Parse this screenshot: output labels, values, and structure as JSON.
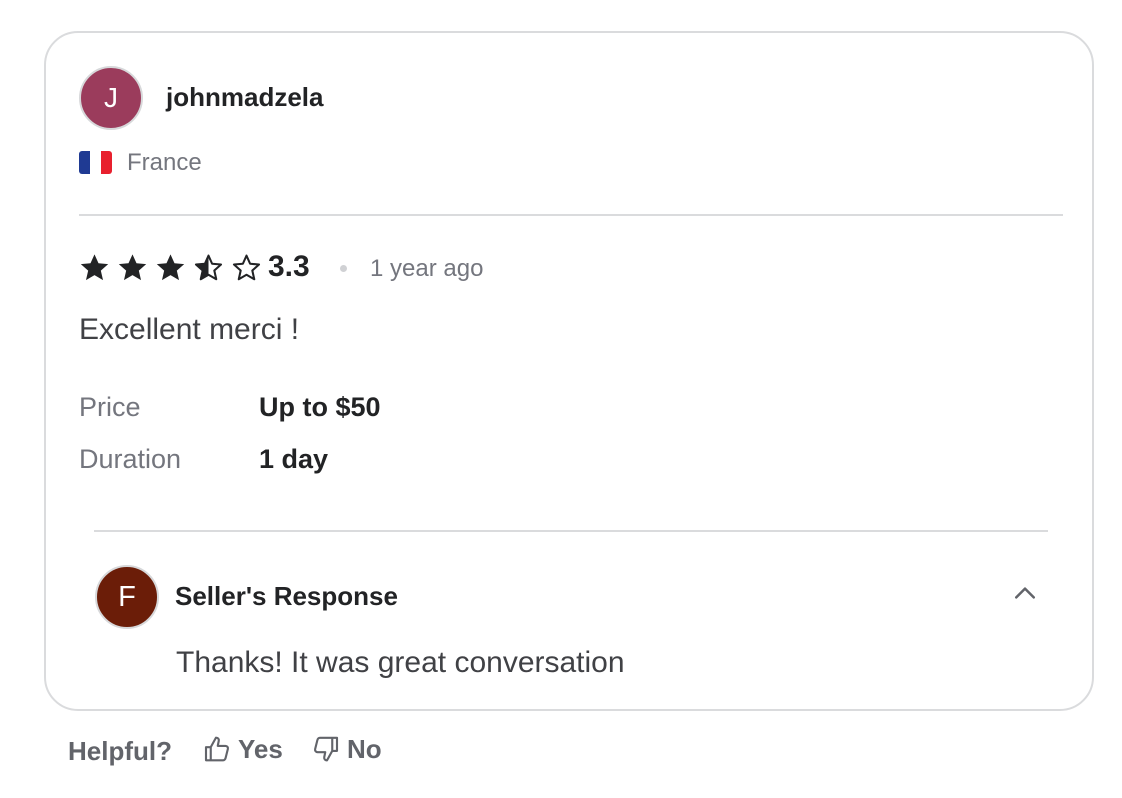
{
  "reviewer": {
    "avatar_initial": "J",
    "avatar_color": "#9b3c5c",
    "username": "johnmadzela",
    "country": "France",
    "flag_icon": "france-flag-icon",
    "flag_colors": [
      "#1f3a93",
      "#ffffff",
      "#e8202e"
    ]
  },
  "review": {
    "rating": 3.3,
    "rating_label": "3.3",
    "stars": [
      "full",
      "full",
      "full",
      "half",
      "empty"
    ],
    "time_ago": "1 year ago",
    "text": "Excellent merci !",
    "details": [
      {
        "label": "Price",
        "value": "Up to $50"
      },
      {
        "label": "Duration",
        "value": "1 day"
      }
    ]
  },
  "seller_response": {
    "avatar_initial": "F",
    "avatar_color": "#6b1d08",
    "title": "Seller's Response",
    "text": "Thanks! It was great conversation",
    "toggle_icon": "chevron-up-icon"
  },
  "feedback": {
    "prompt": "Helpful?",
    "yes_label": "Yes",
    "no_label": "No",
    "yes_icon": "thumbs-up-icon",
    "no_icon": "thumbs-down-icon"
  },
  "colors": {
    "text_primary": "#222325",
    "text_secondary": "#74767e",
    "border": "#dadbdd"
  }
}
